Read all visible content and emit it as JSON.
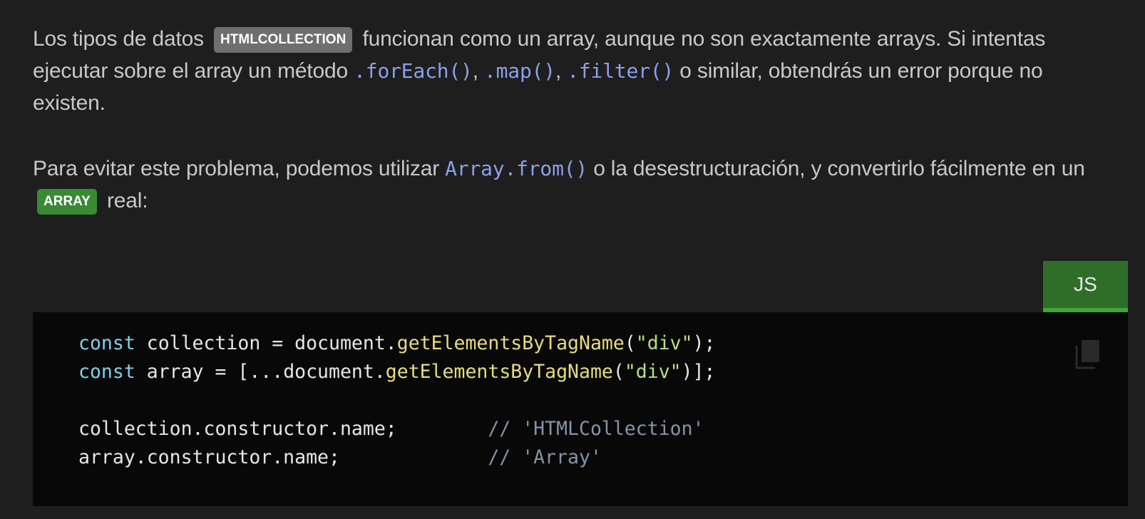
{
  "article": {
    "p1": {
      "t1": "Los tipos de datos",
      "tag": "HTMLCOLLECTION",
      "t2": "funcionan como un array, aunque no son exactamente arrays. Si intentas ejecutar sobre el array un método",
      "c1": ".forEach()",
      "t3": ",",
      "c2": ".map()",
      "t4": ",",
      "c3": ".filter()",
      "t5": "o similar, obtendrás un error porque no existen."
    },
    "p2": {
      "t1": "Para evitar este problema, podemos utilizar",
      "c1": "Array.from()",
      "t2": "o la desestructuración, y convertirlo fácilmente en un",
      "tag": "ARRAY",
      "t3": "real:"
    }
  },
  "code_block": {
    "language_tab": "JS",
    "copy_icon": "copy-icon",
    "lines": [
      [
        {
          "t": "const",
          "c": "kw"
        },
        {
          "t": " collection = document.",
          "c": ""
        },
        {
          "t": "getElementsByTagName",
          "c": "fn"
        },
        {
          "t": "(",
          "c": ""
        },
        {
          "t": "\"div\"",
          "c": "str"
        },
        {
          "t": ");",
          "c": ""
        }
      ],
      [
        {
          "t": "const",
          "c": "kw"
        },
        {
          "t": " array = [...document.",
          "c": ""
        },
        {
          "t": "getElementsByTagName",
          "c": "fn"
        },
        {
          "t": "(",
          "c": ""
        },
        {
          "t": "\"div\"",
          "c": "str"
        },
        {
          "t": ")];",
          "c": ""
        }
      ],
      [],
      [
        {
          "t": "collection.constructor.name;        ",
          "c": ""
        },
        {
          "t": "// 'HTMLCollection'",
          "c": "cm"
        }
      ],
      [
        {
          "t": "array.constructor.name;             ",
          "c": ""
        },
        {
          "t": "// 'Array'",
          "c": "cm"
        }
      ]
    ]
  },
  "colors": {
    "background": "#1e1e1e",
    "inline_code": "#8aa0ea",
    "tag_gray": "#6f6f6f",
    "tag_green": "#3a8a34",
    "code_bg": "#080808"
  }
}
